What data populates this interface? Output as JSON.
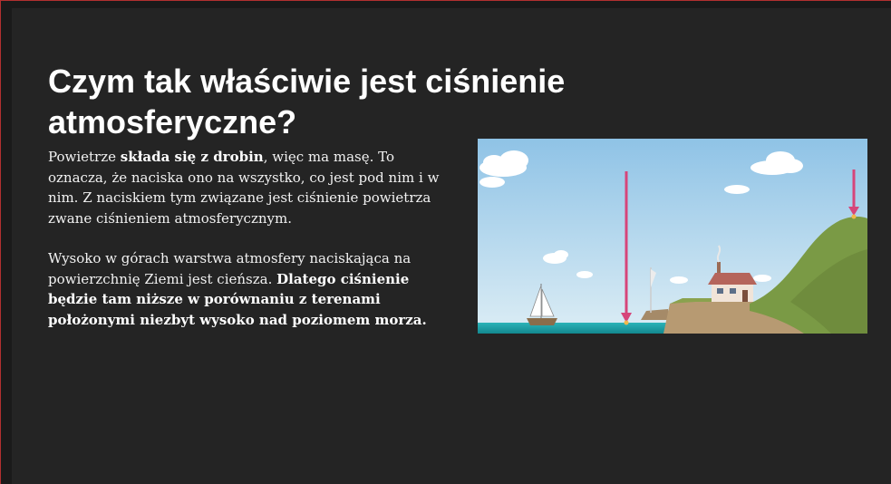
{
  "slide": {
    "title": "Czym tak właściwie jest ciśnienie atmosferyczne?",
    "paragraph1": {
      "part1": "Powietrze ",
      "bold1": "składa się z drobin",
      "part2": ", więc ma masę. To oznacza, że naciska ono na wszystko, co jest pod nim i w nim. Z naciskiem tym związane jest ciśnienie powietrza zwane ciśnieniem atmosferycznym."
    },
    "paragraph2": {
      "part1": "Wysoko w górach warstwa atmosfery naciskająca na powierzchnię Ziemi jest cieńsza. ",
      "bold1": "Dlatego ciśnienie będzie tam niższe w porównaniu z terenami położonymi niezbyt wysoko nad poziomem morza."
    }
  },
  "colors": {
    "background": "#242424",
    "title": "#ffffff",
    "text": "#f2f2f2",
    "arrow": "#d6457a",
    "sky_top": "#8fc3e6",
    "sea": "#1f9fa8",
    "hill": "#7a9a45"
  },
  "icons": {
    "arrow": "down-arrow-icon",
    "boat": "sailboat-icon",
    "house": "house-icon"
  }
}
